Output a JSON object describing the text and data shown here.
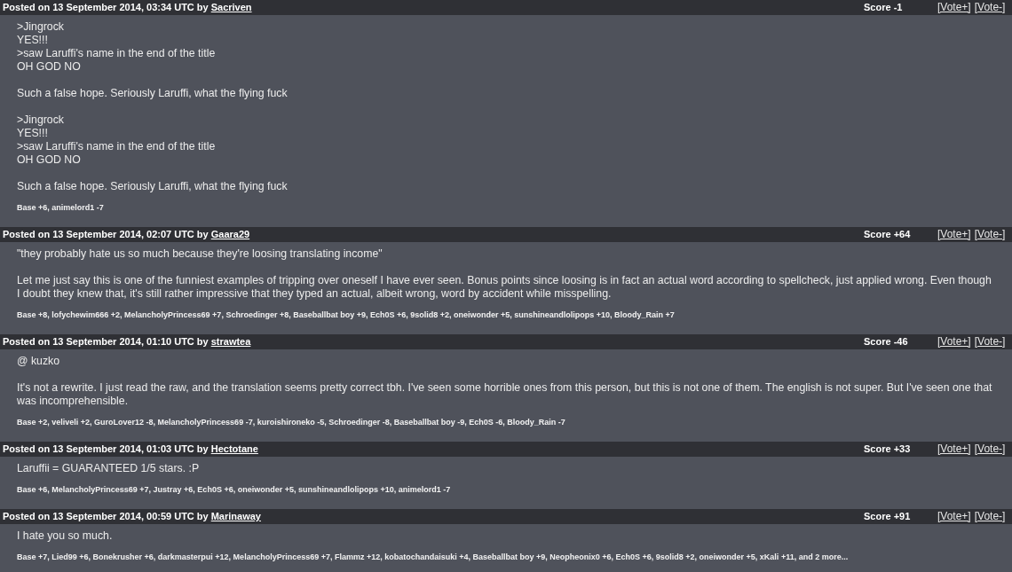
{
  "comments": [
    {
      "posted": "Posted on 13 September 2014, 03:34 UTC by",
      "author": "Sacriven",
      "score": "Score -1",
      "vote_up": "[Vote+]",
      "vote_down": "[Vote-]",
      "paragraphs": [
        ">Jingrock\nYES!!!\n>saw Laruffi's name in the end of the title\nOH GOD NO",
        "Such a false hope. Seriously Laruffi, what the flying fuck",
        ">Jingrock\nYES!!!\n>saw Laruffi's name in the end of the title\nOH GOD NO",
        "Such a false hope. Seriously Laruffi, what the flying fuck"
      ],
      "votes": "Base +6, animelord1 -7"
    },
    {
      "posted": "Posted on 13 September 2014, 02:07 UTC by",
      "author": "Gaara29",
      "score": "Score +64",
      "vote_up": "[Vote+]",
      "vote_down": "[Vote-]",
      "paragraphs": [
        "\"they probably hate us so much because they're loosing translating income\"",
        "Let me just say this is one of the funniest examples of tripping over oneself I have ever seen. Bonus points since loosing is in fact an actual word according to spellcheck, just applied wrong. Even though I doubt they knew that, it's still rather impressive that they typed an actual, albeit wrong, word by accident while misspelling."
      ],
      "votes": "Base +8, lofychewim666 +2, MelancholyPrincess69 +7, Schroedinger +8, Baseballbat boy +9, Ech0S +6, 9solid8 +2, oneiwonder +5, sunshineandlolipops +10, Bloody_Rain +7"
    },
    {
      "posted": "Posted on 13 September 2014, 01:10 UTC by",
      "author": "strawtea",
      "score": "Score -46",
      "vote_up": "[Vote+]",
      "vote_down": "[Vote-]",
      "paragraphs": [
        "@ kuzko",
        "It's not a rewrite. I just read the raw, and the translation seems pretty correct tbh. I've seen some horrible ones from this person, but this is not one of them. The english is not super. But I've seen one that was incomprehensible."
      ],
      "votes": "Base +2, veliveli +2, GuroLover12 -8, MelancholyPrincess69 -7, kuroishironeko -5, Schroedinger -8, Baseballbat boy -9, Ech0S -6, Bloody_Rain -7"
    },
    {
      "posted": "Posted on 13 September 2014, 01:03 UTC by",
      "author": "Hectotane",
      "score": "Score +33",
      "vote_up": "[Vote+]",
      "vote_down": "[Vote-]",
      "paragraphs": [
        "Laruffii = GUARANTEED 1/5 stars. :P"
      ],
      "votes": "Base +6, MelancholyPrincess69 +7, Justray +6, Ech0S +6, oneiwonder +5, sunshineandlolipops +10, animelord1 -7"
    },
    {
      "posted": "Posted on 13 September 2014, 00:59 UTC by",
      "author": "Marinaway",
      "score": "Score +91",
      "vote_up": "[Vote+]",
      "vote_down": "[Vote-]",
      "paragraphs": [
        "I hate you so much."
      ],
      "votes": "Base +7, Lied99 +6, Bonekrusher +6, darkmasterpui +12, MelancholyPrincess69 +7, Flammz +12, kobatochandaisuki +4, Baseballbat boy +9, Neopheonix0 +6, Ech0S +6, 9solid8 +2, oneiwonder +5, xKali +11, and 2 more..."
    }
  ]
}
